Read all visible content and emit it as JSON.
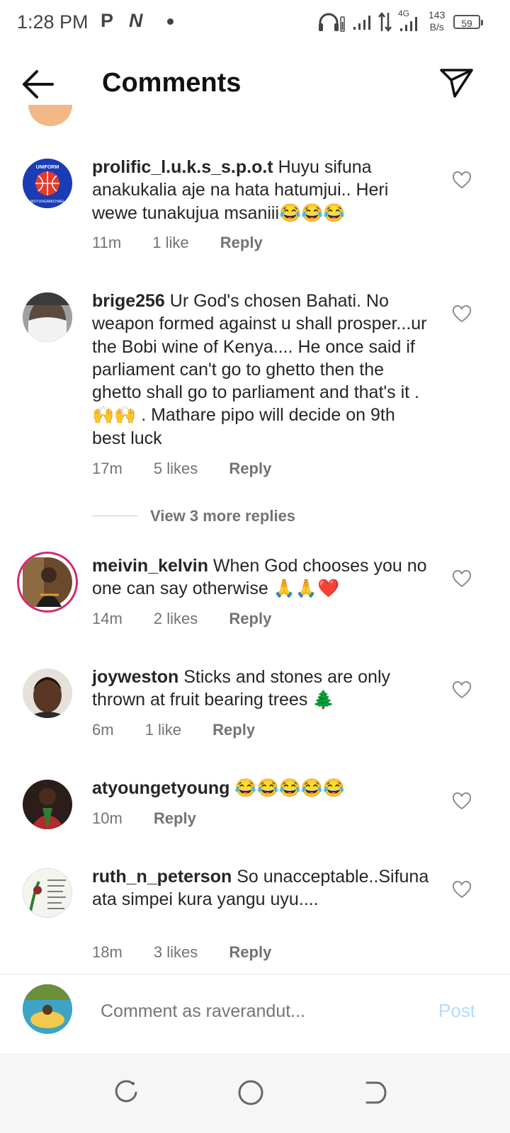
{
  "status_bar": {
    "time": "1:28 PM",
    "icon_p": "P",
    "icon_n": "N",
    "net_speed_value": "143",
    "net_speed_unit": "B/s",
    "network_type": "4G",
    "battery": "59"
  },
  "header": {
    "title": "Comments"
  },
  "comments": [
    {
      "username": "prolific_l.u.k.s_s.p.o.t",
      "text": " Huyu sifuna anakukalia aje na hata hatumjui.. Heri wewe tunakujua msaniii😂😂😂",
      "time": "11m",
      "likes": "1 like",
      "reply": "Reply"
    },
    {
      "username": "brige256",
      "text": " Ur God's chosen Bahati. No weapon formed against u shall prosper...ur the Bobi wine of Kenya.... He once said if parliament can't go to ghetto then the ghetto shall go to parliament and that's it .🙌🙌 . Mathare pipo will decide on 9th  best luck",
      "time": "17m",
      "likes": "5 likes",
      "reply": "Reply"
    },
    {
      "username": "meivin_kelvin",
      "text": " When God chooses you no one can say otherwise 🙏🙏❤️",
      "time": "14m",
      "likes": "2 likes",
      "reply": "Reply"
    },
    {
      "username": "joyweston",
      "text": " Sticks and stones are only thrown at fruit bearing trees 🌲",
      "time": "6m",
      "likes": "1 like",
      "reply": "Reply"
    },
    {
      "username": "atyoungetyoung",
      "text": " 😂😂😂😂😂",
      "time": "10m",
      "reply": "Reply"
    },
    {
      "username": "ruth_n_peterson",
      "text": " So unacceptable..Sifuna ata simpei kura yangu uyu....",
      "time": "18m",
      "likes": "3 likes",
      "reply": "Reply"
    }
  ],
  "view_more_replies": "View 3 more replies",
  "avatar_badges": {
    "uniform_top": "UNIFORM",
    "uniform_bottom": "@OTUNGAMICHAEL"
  },
  "comment_input": {
    "placeholder": "Comment as raverandut...",
    "post_label": "Post"
  },
  "colors": {
    "muted_text": "#737373",
    "post_disabled": "#b3dbff",
    "story_ring": "#d6286f"
  }
}
